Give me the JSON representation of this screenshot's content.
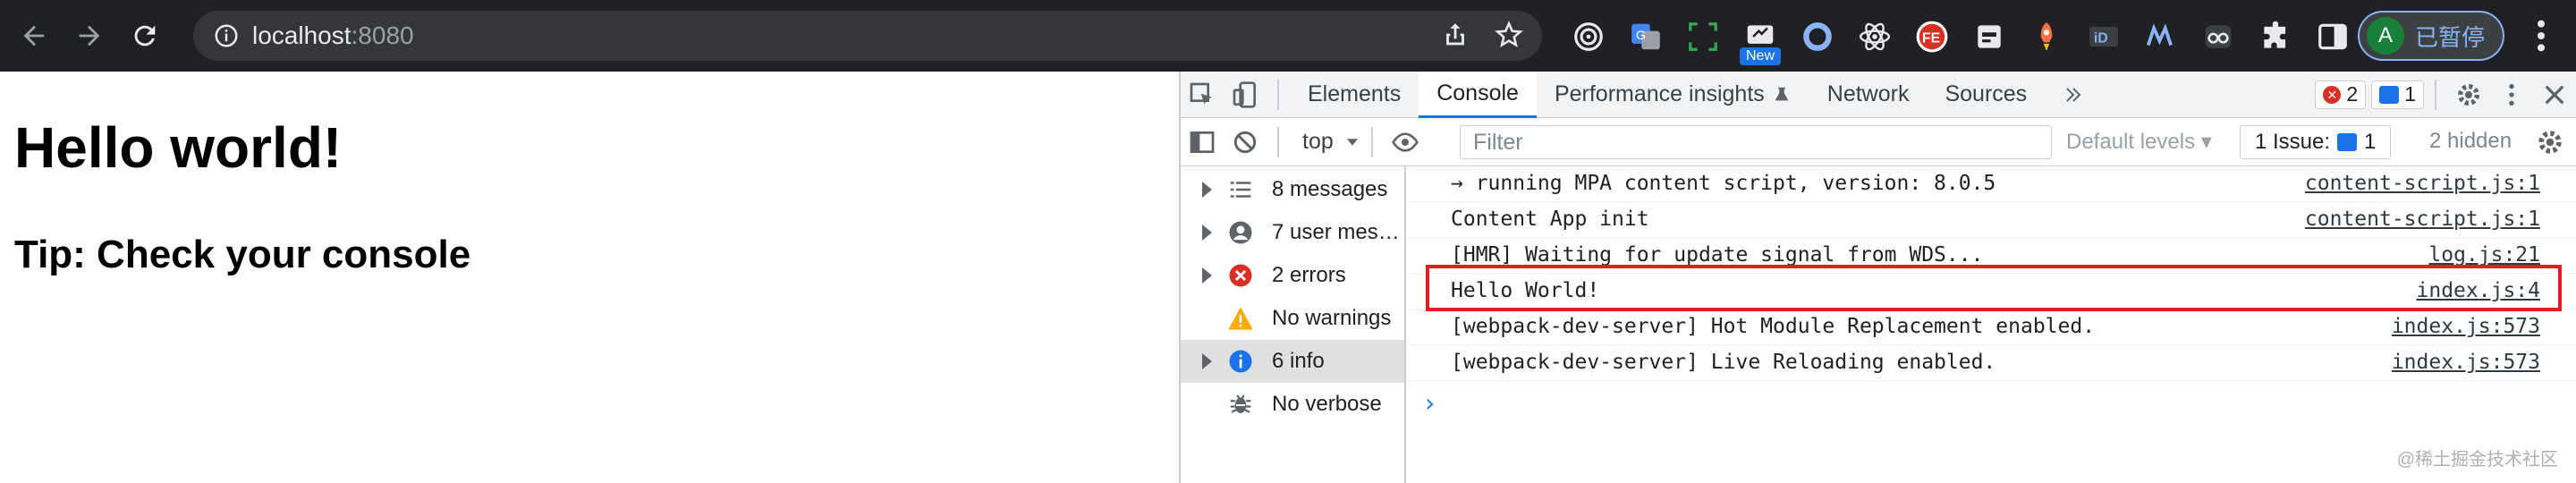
{
  "browser": {
    "url_host": "localhost",
    "url_port": ":8080",
    "extension_new_badge": "New",
    "profile_initial": "A",
    "profile_label": "已暂停"
  },
  "page": {
    "heading": "Hello world!",
    "subheading": "Tip: Check your console"
  },
  "devtools": {
    "tabs": [
      "Elements",
      "Console",
      "Performance insights",
      "Network",
      "Sources"
    ],
    "error_count": "2",
    "message_count": "1",
    "context": "top",
    "filter_placeholder": "Filter",
    "levels": "Default levels",
    "issues_label": "1 Issue:",
    "issues_count": "1",
    "hidden_label": "2 hidden",
    "sidebar": [
      {
        "label": "8 messages",
        "icon": "list-icon"
      },
      {
        "label": "7 user messages",
        "icon": "user-icon"
      },
      {
        "label": "2 errors",
        "icon": "error-icon"
      },
      {
        "label": "No warnings",
        "icon": "warning-icon"
      },
      {
        "label": "6 info",
        "icon": "info-icon"
      },
      {
        "label": "No verbose",
        "icon": "bug-icon"
      }
    ],
    "console_rows": [
      {
        "text": "→ running MPA content script, version: 8.0.5",
        "source": "content-script.js:1"
      },
      {
        "text": "Content App init",
        "source": "content-script.js:1"
      },
      {
        "text": "[HMR] Waiting for update signal from WDS...",
        "source": "log.js:21"
      },
      {
        "text": "Hello World!",
        "source": "index.js:4"
      },
      {
        "text": "[webpack-dev-server] Hot Module Replacement enabled.",
        "source": "index.js:573"
      },
      {
        "text": "[webpack-dev-server] Live Reloading enabled.",
        "source": "index.js:573"
      }
    ],
    "prompt": "›"
  },
  "watermark": "@稀土掘金技术社区",
  "colors": {
    "chrome_bg": "#202124",
    "accent": "#1a73e8",
    "highlight": "#e02020"
  }
}
